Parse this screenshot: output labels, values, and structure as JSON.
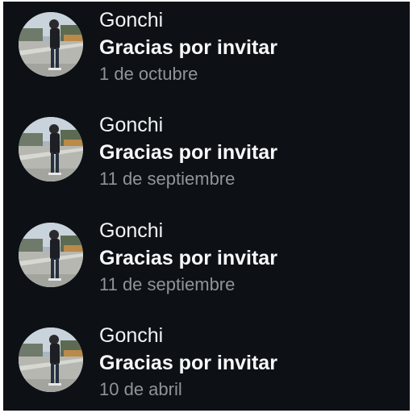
{
  "notifications": [
    {
      "sender": "Gonchi",
      "message": "Gracias por invitar",
      "date": "1 de octubre",
      "avatar_icon": "profile-photo"
    },
    {
      "sender": "Gonchi",
      "message": "Gracias por invitar",
      "date": "11 de septiembre",
      "avatar_icon": "profile-photo"
    },
    {
      "sender": "Gonchi",
      "message": "Gracias por invitar",
      "date": "11 de septiembre",
      "avatar_icon": "profile-photo"
    },
    {
      "sender": "Gonchi",
      "message": "Gracias por invitar",
      "date": "10 de abril",
      "avatar_icon": "profile-photo"
    }
  ],
  "colors": {
    "background": "#0d1115",
    "primary_text": "#f1f3f5",
    "secondary_text": "#8e949a"
  }
}
